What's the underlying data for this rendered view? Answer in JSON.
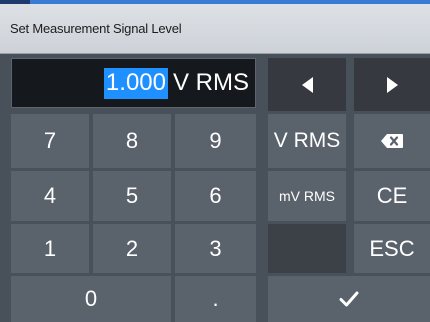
{
  "dialog": {
    "title": "Set Measurement Signal Level"
  },
  "display": {
    "selected_value": "1.000",
    "unit": "V RMS"
  },
  "keypad": {
    "digits": [
      "7",
      "8",
      "9",
      "4",
      "5",
      "6",
      "1",
      "2",
      "3",
      "0",
      "."
    ],
    "unit_vrms": "V RMS",
    "unit_mvrms": "mV RMS",
    "clear_entry": "CE",
    "escape": "ESC"
  },
  "icons": {
    "cursor_left": "left-arrow-icon",
    "cursor_right": "right-arrow-icon",
    "backspace": "backspace-icon",
    "enter": "checkmark-icon"
  },
  "colors": {
    "selection_highlight": "#1e90ff",
    "key_background": "#5a626c",
    "dialog_background": "#48505a"
  }
}
